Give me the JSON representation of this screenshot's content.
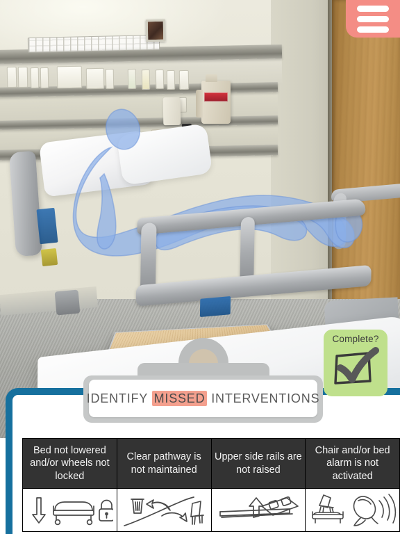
{
  "app": {
    "title": "IDENTIFY MISSED INTERVENTIONS",
    "title_parts": {
      "before": "IDENTIFY",
      "highlight": "MISSED",
      "after": "INTERVENTIONS"
    }
  },
  "colors": {
    "accent_menu": "#F48D85",
    "panel_blue": "#16709E",
    "highlight_salmon": "#F4A08E",
    "complete_green": "#BFE08C",
    "header_dark": "#333333",
    "avatar_blue": "#8BAEE8"
  },
  "menu": {
    "name": "hamburger-menu",
    "icon": "hamburger-icon",
    "bars": 3
  },
  "complete_badge": {
    "label": "Complete?",
    "icon": "checkbox-checked-icon",
    "checked": true
  },
  "scene": {
    "name": "ar-hospital-room",
    "description": "Augmented reality hospital patient room with hospital bed, blue translucent patient avatar, headwall with outlets, sharps container, wooden door, floor mat",
    "avatar_label": "patient-avatar-blue"
  },
  "table": {
    "name": "missed-interventions-table",
    "columns": [
      {
        "header": "Bed not lowered and/or wheels not locked",
        "icon": "bed-lower-lock-icon",
        "icon_parts": [
          "down-arrow-icon",
          "bed-icon",
          "padlock-icon"
        ]
      },
      {
        "header": "Clear pathway is not maintained",
        "icon": "clear-pathway-icon",
        "icon_parts": [
          "trash-can-icon",
          "arrow-icon",
          "chair-icon",
          "pathway-line"
        ]
      },
      {
        "header": "Upper side rails are not raised",
        "icon": "side-rail-raise-icon",
        "icon_parts": [
          "bed-rail-icon",
          "up-arrow-icon"
        ]
      },
      {
        "header": "Chair and/or bed alarm is not activated",
        "icon": "alarm-not-activated-icon",
        "icon_parts": [
          "chair-icon",
          "bed-icon",
          "alarm-bell-icon"
        ]
      }
    ]
  }
}
